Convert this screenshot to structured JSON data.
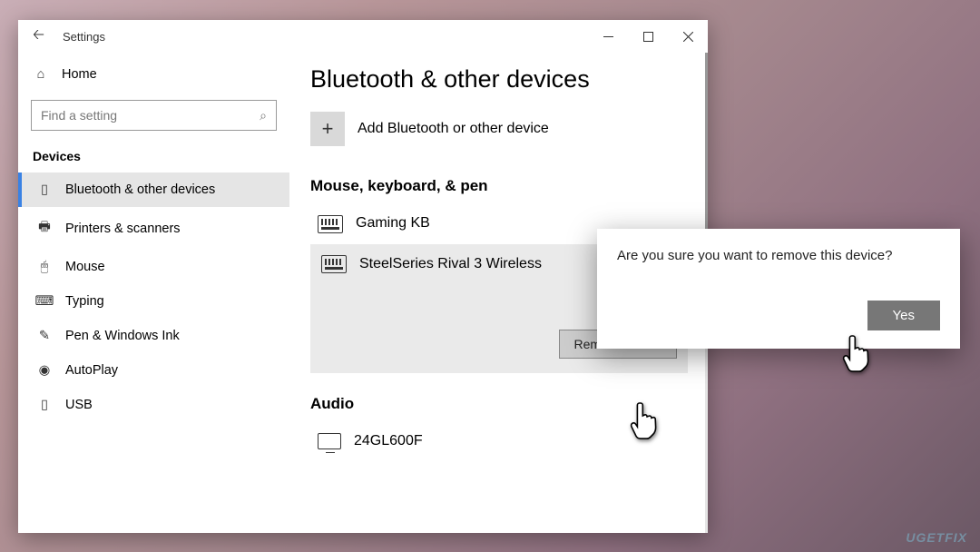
{
  "window": {
    "title": "Settings",
    "home_label": "Home",
    "search_placeholder": "Find a setting",
    "group_label": "Devices"
  },
  "nav": [
    {
      "icon": "bluetooth",
      "label": "Bluetooth & other devices",
      "active": true
    },
    {
      "icon": "printer",
      "label": "Printers & scanners"
    },
    {
      "icon": "mouse",
      "label": "Mouse"
    },
    {
      "icon": "typing",
      "label": "Typing"
    },
    {
      "icon": "pen",
      "label": "Pen & Windows Ink"
    },
    {
      "icon": "autoplay",
      "label": "AutoPlay"
    },
    {
      "icon": "usb",
      "label": "USB"
    }
  ],
  "content": {
    "heading": "Bluetooth & other devices",
    "add_label": "Add Bluetooth or other device",
    "section1": "Mouse, keyboard, & pen",
    "device1": "Gaming KB",
    "device2": "SteelSeries Rival 3 Wireless",
    "remove_label": "Remove device",
    "section2": "Audio",
    "device3": "24GL600F"
  },
  "dialog": {
    "text": "Are you sure you want to remove this device?",
    "yes": "Yes"
  },
  "watermark": "UGETFIX"
}
